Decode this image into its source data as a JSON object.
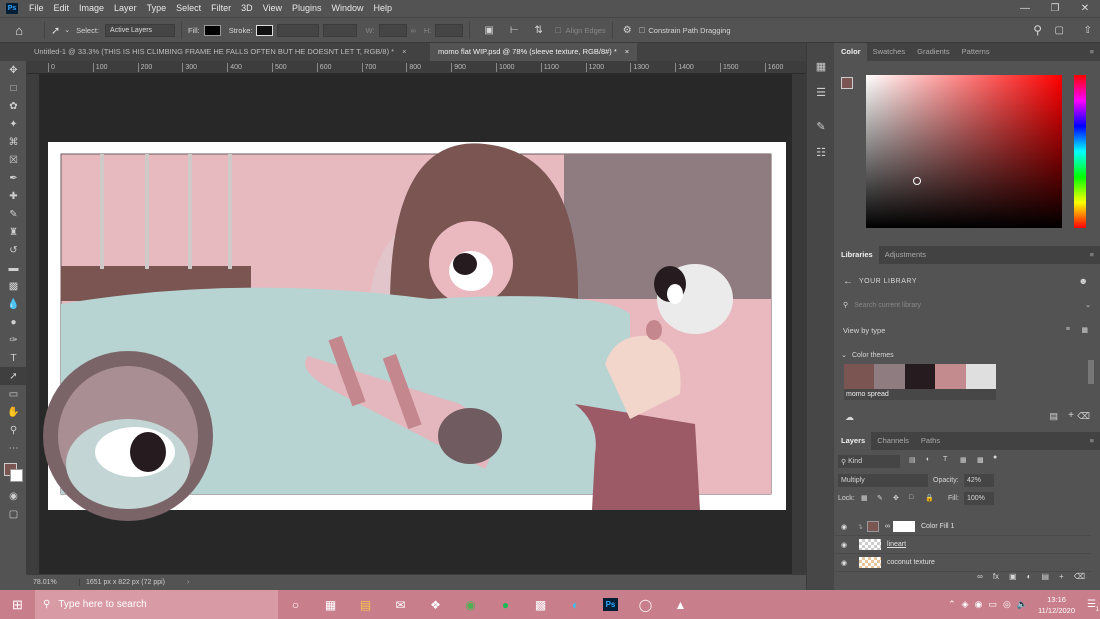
{
  "menu": {
    "logo": "Ps",
    "items": [
      "File",
      "Edit",
      "Image",
      "Layer",
      "Type",
      "Select",
      "Filter",
      "3D",
      "View",
      "Plugins",
      "Window",
      "Help"
    ]
  },
  "options": {
    "select_label": "Select:",
    "select_value": "Active Layers",
    "fill_label": "Fill:",
    "stroke_label": "Stroke:",
    "w_label": "W:",
    "h_label": "H:",
    "align_edges": "Align Edges",
    "constrain": "Constrain Path Dragging"
  },
  "tabs": [
    {
      "label": "Untitled-1 @ 33.3% (THIS IS HIS  CLIMBING FRAME HE FALLS OFTEN BUT HE DOESNT  LET T, RGB/8) *",
      "active": false
    },
    {
      "label": "momo flat WIP.psd @ 78% (sleeve texture, RGB/8#) *",
      "active": true
    }
  ],
  "ruler_ticks": [
    "0",
    "100",
    "200",
    "300",
    "400",
    "500",
    "600",
    "700",
    "800",
    "900",
    "1000",
    "1100",
    "1200",
    "1300",
    "1400",
    "1500",
    "1600"
  ],
  "status": {
    "zoom": "78.01%",
    "doc_size": "1651 px x 822 px (72 ppi)"
  },
  "color_panel": {
    "tabs": [
      "Color",
      "Swatches",
      "Gradients",
      "Patterns"
    ],
    "fg_color": "#7a5552",
    "bg_color": "#ffffff"
  },
  "libraries": {
    "tabs": [
      "Libraries",
      "Adjustments"
    ],
    "your_library": "YOUR LIBRARY",
    "search_placeholder": "Search current library",
    "view_by": "View by type",
    "color_themes": "Color themes",
    "theme_name": "momo spread",
    "theme_colors": [
      "#7a5552",
      "#8e7c80",
      "#261c20",
      "#c48b8e",
      "#e0dfe0"
    ]
  },
  "layers": {
    "tabs": [
      "Layers",
      "Channels",
      "Paths"
    ],
    "kind": "Kind",
    "blend_mode": "Multiply",
    "opacity_label": "Opacity:",
    "opacity_value": "42%",
    "lock_label": "Lock:",
    "fill_label": "Fill:",
    "fill_value": "100%",
    "rows": [
      {
        "name": "Color Fill 1"
      },
      {
        "name": "lineart"
      },
      {
        "name": "coconut texture"
      }
    ]
  },
  "taskbar": {
    "search_placeholder": "Type here to search",
    "time": "13:16",
    "date": "11/12/2020",
    "notif_count": "1"
  },
  "colors": {
    "canvas_bg": "#e7bac0",
    "accent": "#31a8ff",
    "taskbar": "#c97e8c"
  }
}
